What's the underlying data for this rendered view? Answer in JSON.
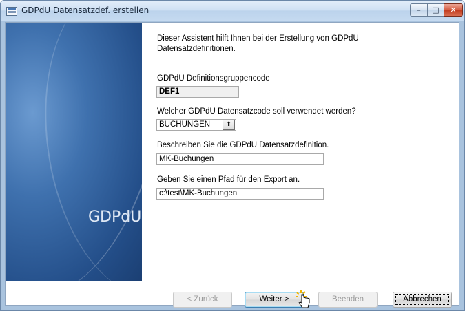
{
  "window": {
    "title": "GDPdU Datensatzdef. erstellen",
    "controls": {
      "minimize": "–",
      "maximize": "□",
      "close": "✕"
    }
  },
  "side_panel": {
    "brand": "GDPdU"
  },
  "intro_text": "Dieser Assistent hilft Ihnen bei der Erstellung von GDPdU Datensatzdefinitionen.",
  "fields": {
    "group_code": {
      "label": "GDPdU Definitionsgruppencode",
      "value": "DEF1"
    },
    "record_code": {
      "label": "Welcher GDPdU Datensatzcode soll verwendet werden?",
      "value": "BUCHUNGEN",
      "button": "⬆"
    },
    "description": {
      "label": "Beschreiben Sie die GDPdU Datensatzdefinition.",
      "value": "MK-Buchungen"
    },
    "export_path": {
      "label": "Geben Sie einen Pfad für den Export an.",
      "value": "c:\\test\\MK-Buchungen"
    }
  },
  "buttons": {
    "back": "< Zurück",
    "next": "Weiter >",
    "finish": "Beenden",
    "cancel": "Abbrechen"
  },
  "colors": {
    "accent": "#3c7fb1",
    "panel": "#2b5b97",
    "close": "#c13a1d"
  },
  "icons": {
    "app": "window-app-icon",
    "cursor": "hand-pointer-icon"
  }
}
